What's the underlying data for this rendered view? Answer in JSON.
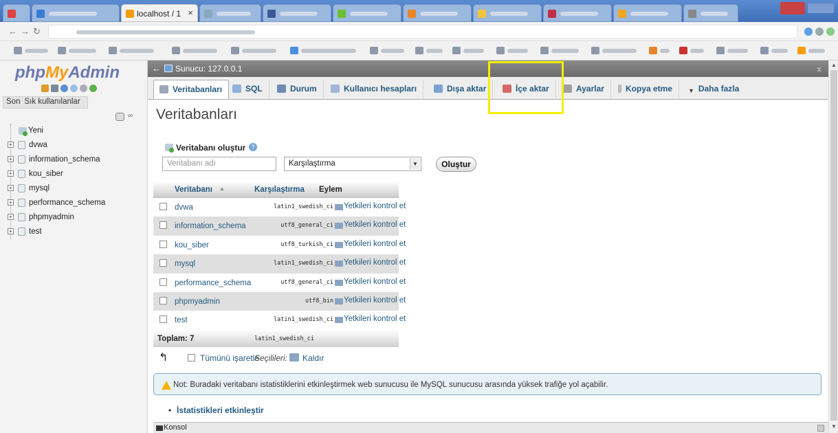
{
  "browser": {
    "active_tab_title": "localhost / 1",
    "active_tab_close": "×"
  },
  "logo": {
    "php": "php",
    "my": "My",
    "admin": "Admin"
  },
  "nav": {
    "links": [
      "Son",
      "Sık kullanılanlar"
    ],
    "tree": [
      {
        "label": "Yeni",
        "type": "new"
      },
      {
        "label": "dvwa",
        "type": "db"
      },
      {
        "label": "information_schema",
        "type": "db"
      },
      {
        "label": "kou_siber",
        "type": "db"
      },
      {
        "label": "mysql",
        "type": "db"
      },
      {
        "label": "performance_schema",
        "type": "db"
      },
      {
        "label": "phpmyadmin",
        "type": "db"
      },
      {
        "label": "test",
        "type": "db"
      }
    ]
  },
  "server_bar": {
    "label": "Sunucu: 127.0.0.1"
  },
  "menu": {
    "tabs": [
      {
        "label": "Veritabanları",
        "active": true,
        "icon": "database-icon",
        "color": "#9aa7b6"
      },
      {
        "label": "SQL",
        "active": false,
        "icon": "sql-icon",
        "color": "#8fb0d9"
      },
      {
        "label": "Durum",
        "active": false,
        "icon": "status-icon",
        "color": "#6f8ab3"
      },
      {
        "label": "Kullanıcı hesapları",
        "active": false,
        "icon": "users-icon",
        "color": "#9fb7d6"
      },
      {
        "label": "Dışa aktar",
        "active": false,
        "icon": "export-icon",
        "color": "#7aa3d0"
      },
      {
        "label": "İçe aktar",
        "active": false,
        "icon": "import-icon",
        "color": "#d46a6a"
      },
      {
        "label": "Ayarlar",
        "active": false,
        "icon": "wrench-icon",
        "color": "#a0a0a0"
      },
      {
        "label": "Kopya etme",
        "active": false,
        "icon": "replication-icon",
        "color": "#b7b7b7"
      },
      {
        "label": "Daha fazla",
        "active": false,
        "icon": "chevron-down-icon",
        "color": "#444444"
      }
    ]
  },
  "main": {
    "title": "Veritabanları",
    "create": {
      "label": "Veritabanı oluştur",
      "name_placeholder": "Veritabanı adı",
      "collation_value": "Karşılaştırma",
      "button": "Oluştur"
    },
    "table": {
      "headers": [
        "Veritabanı",
        "Karşılaştırma",
        "Eylem"
      ],
      "rows": [
        {
          "name": "dvwa",
          "collation": "latin1_swedish_ci",
          "action": "Yetkileri kontrol et"
        },
        {
          "name": "information_schema",
          "collation": "utf8_general_ci",
          "action": "Yetkileri kontrol et"
        },
        {
          "name": "kou_siber",
          "collation": "utf8_turkish_ci",
          "action": "Yetkileri kontrol et"
        },
        {
          "name": "mysql",
          "collation": "latin1_swedish_ci",
          "action": "Yetkileri kontrol et"
        },
        {
          "name": "performance_schema",
          "collation": "utf8_general_ci",
          "action": "Yetkileri kontrol et"
        },
        {
          "name": "phpmyadmin",
          "collation": "utf8_bin",
          "action": "Yetkileri kontrol et"
        },
        {
          "name": "test",
          "collation": "latin1_swedish_ci",
          "action": "Yetkileri kontrol et"
        }
      ],
      "footer": {
        "label": "Toplam: 7",
        "collation": "latin1_swedish_ci"
      }
    },
    "bulk": {
      "check_all": "Tümünü işaretle",
      "with_selected": "Seçilileri:",
      "drop": "Kaldır"
    },
    "notice": "Not: Buradaki veritabanı istatistiklerini etkinleştirmek web sunucusu ile MySQL sunucusu arasında yüksek trafiğe yol açabilir.",
    "stats_link": "İstatistikleri etkinleştir"
  },
  "console": {
    "label": "Konsol"
  },
  "colors": {
    "link": "#235a81",
    "logo_orange": "#f89c0e",
    "logo_blue": "#6c78af",
    "highlight": "#f5ee00"
  }
}
